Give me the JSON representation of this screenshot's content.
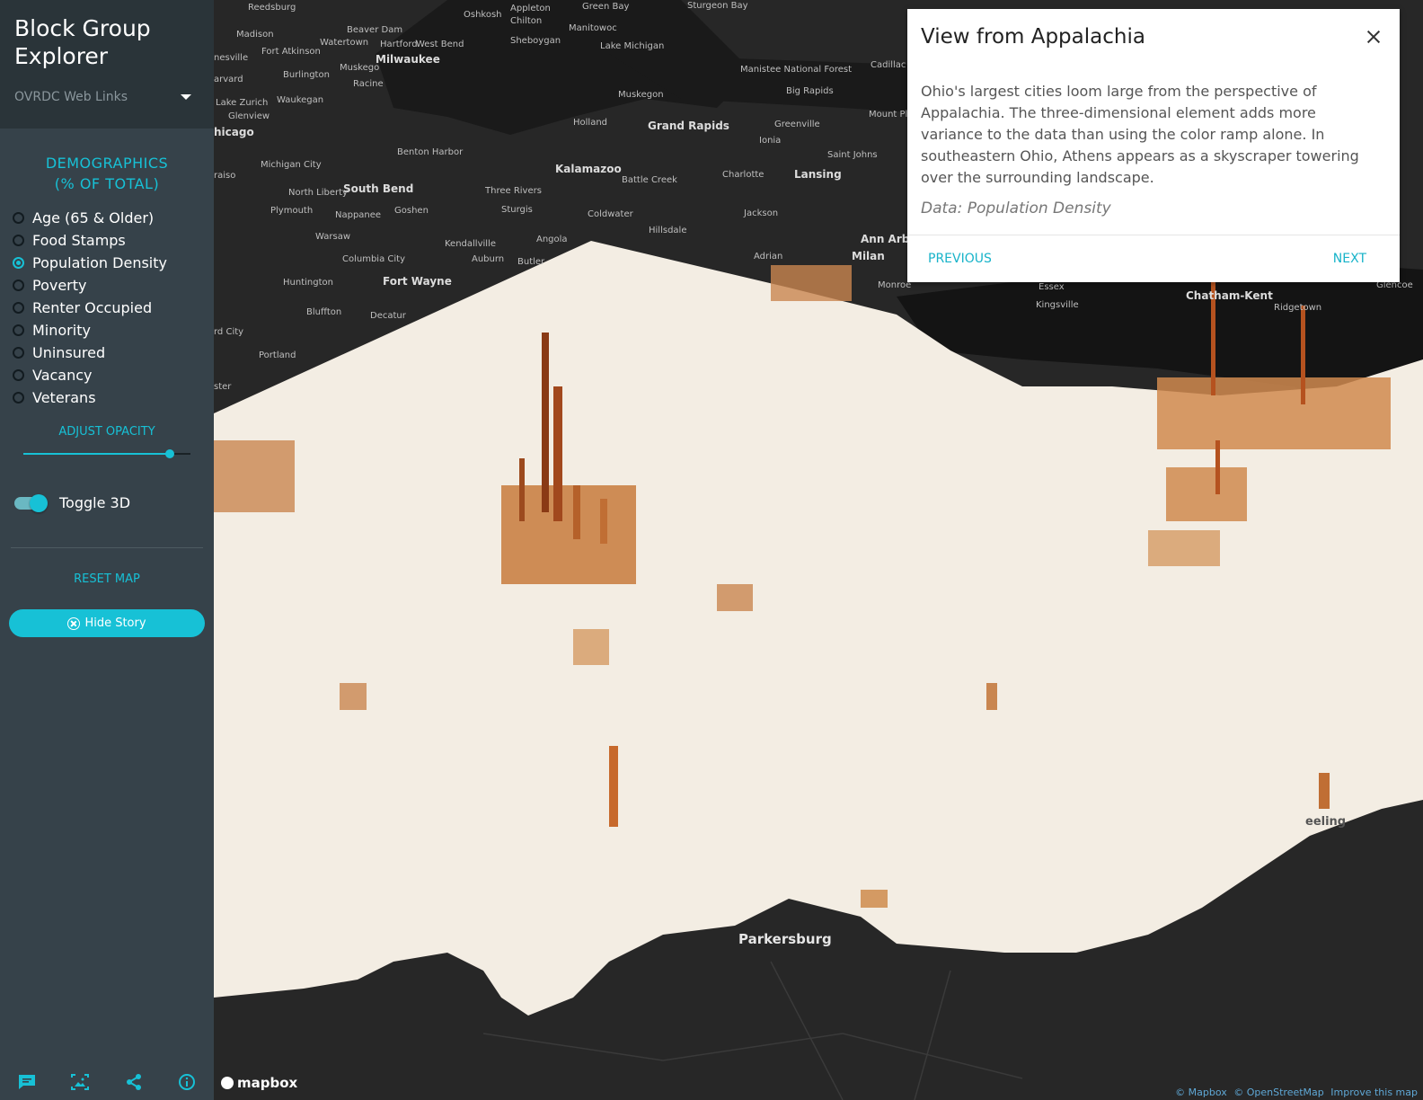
{
  "sidebar": {
    "title": "Block Group Explorer",
    "weblinks_label": "OVRDC Web Links",
    "section_title_line1": "DEMOGRAPHICS",
    "section_title_line2": "(% OF TOTAL)",
    "options": [
      {
        "label": "Age (65 & Older)",
        "checked": false
      },
      {
        "label": "Food Stamps",
        "checked": false
      },
      {
        "label": "Population Density",
        "checked": true
      },
      {
        "label": "Poverty",
        "checked": false
      },
      {
        "label": "Renter Occupied",
        "checked": false
      },
      {
        "label": "Minority",
        "checked": false
      },
      {
        "label": "Uninsured",
        "checked": false
      },
      {
        "label": "Vacancy",
        "checked": false
      },
      {
        "label": "Veterans",
        "checked": false
      }
    ],
    "opacity_label": "ADJUST OPACITY",
    "opacity_value": 0.9,
    "toggle_label": "Toggle 3D",
    "toggle_on": true,
    "reset_label": "RESET MAP",
    "hide_story_label": "Hide Story",
    "bottom_icons": [
      "chat-icon",
      "image-icon",
      "share-icon",
      "info-icon"
    ]
  },
  "map": {
    "cities": [
      "Reedsburg",
      "Oshkosh",
      "Appleton",
      "Green Bay",
      "Sturgeon Bay",
      "Chilton",
      "Beaver Dam",
      "Manitowoc",
      "Madison",
      "Sheboygan",
      "Fort Atkinson",
      "Watertown",
      "Hartford",
      "West Bend",
      "Lake Michigan",
      "nesville",
      "Milwaukee",
      "Muskego",
      "Burlington",
      "arvard",
      "Racine",
      "Lake Zurich",
      "Waukegan",
      "Glenview",
      "hicago",
      "Michigan City",
      "Benton Harbor",
      "raiso",
      "South Bend",
      "North Liberty",
      "Three Rivers",
      "Plymouth",
      "Nappanee",
      "Goshen",
      "Sturgis",
      "Warsaw",
      "Kendallville",
      "Angola",
      "Columbia City",
      "Auburn",
      "Butler",
      "Huntington",
      "Fort Wayne",
      "Bluffton",
      "Decatur",
      "rd City",
      "Portland",
      "ster",
      "Kalamazoo",
      "Battle Creek",
      "Charlotte",
      "Lansing",
      "Coldwater",
      "Hillsdale",
      "Jackson",
      "Ann Arbor",
      "Adrian",
      "Milan",
      "Monroe",
      "Grand Rapids",
      "Holland",
      "Muskegon",
      "Big Rapids",
      "Manistee National Forest",
      "Greenville",
      "Ionia",
      "Saint Johns",
      "Cadillac",
      "Mount Ple",
      "Essex",
      "Kingsville",
      "Chatham-Kent",
      "Ridgetown",
      "Glencoe",
      "Parkersburg",
      "eeling"
    ],
    "mapbox_label": "mapbox",
    "attribution": [
      "© Mapbox",
      "© OpenStreetMap",
      "Improve this map"
    ]
  },
  "story": {
    "title": "View from Appalachia",
    "body": "Ohio's largest cities loom large from the perspective of Appalachia. The three-dimensional element adds more variance to the data than using the color ramp alone. In southeastern Ohio, Athens appears as a skyscraper towering over the surrounding landscape.",
    "data_line": "Data: Population Density",
    "prev_label": "PREVIOUS",
    "next_label": "NEXT"
  },
  "colors": {
    "accent": "#17c1d6",
    "sidebar_bg": "#36424a",
    "map_land": "#f3ede3",
    "map_dark": "#262626",
    "extrusion": "#c9742c"
  }
}
